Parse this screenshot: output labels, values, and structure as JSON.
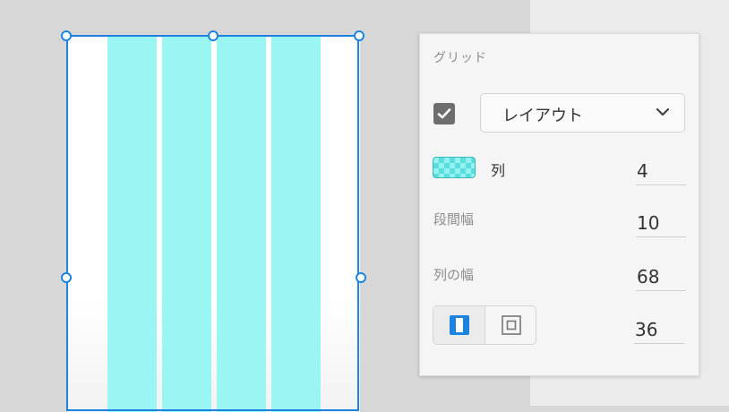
{
  "artboard": {
    "columns": 4,
    "column_color": "#99f6f2",
    "selection_color": "#1c84e0"
  },
  "panel": {
    "title": "グリッド",
    "layout_enabled": true,
    "grid_type": "レイアウト",
    "columns_label": "列",
    "columns_value": "4",
    "gutter_label": "段間幅",
    "gutter_value": "10",
    "column_width_label": "列の幅",
    "column_width_value": "68",
    "margin_value": "36",
    "swatch_colors": [
      "#59dedd",
      "#93f1f0"
    ]
  },
  "icons": {
    "checkbox": "checkmark-icon",
    "dropdown": "chevron-down-icon",
    "margin_linked": "linked-margins-icon",
    "margin_custom": "custom-margins-icon"
  }
}
